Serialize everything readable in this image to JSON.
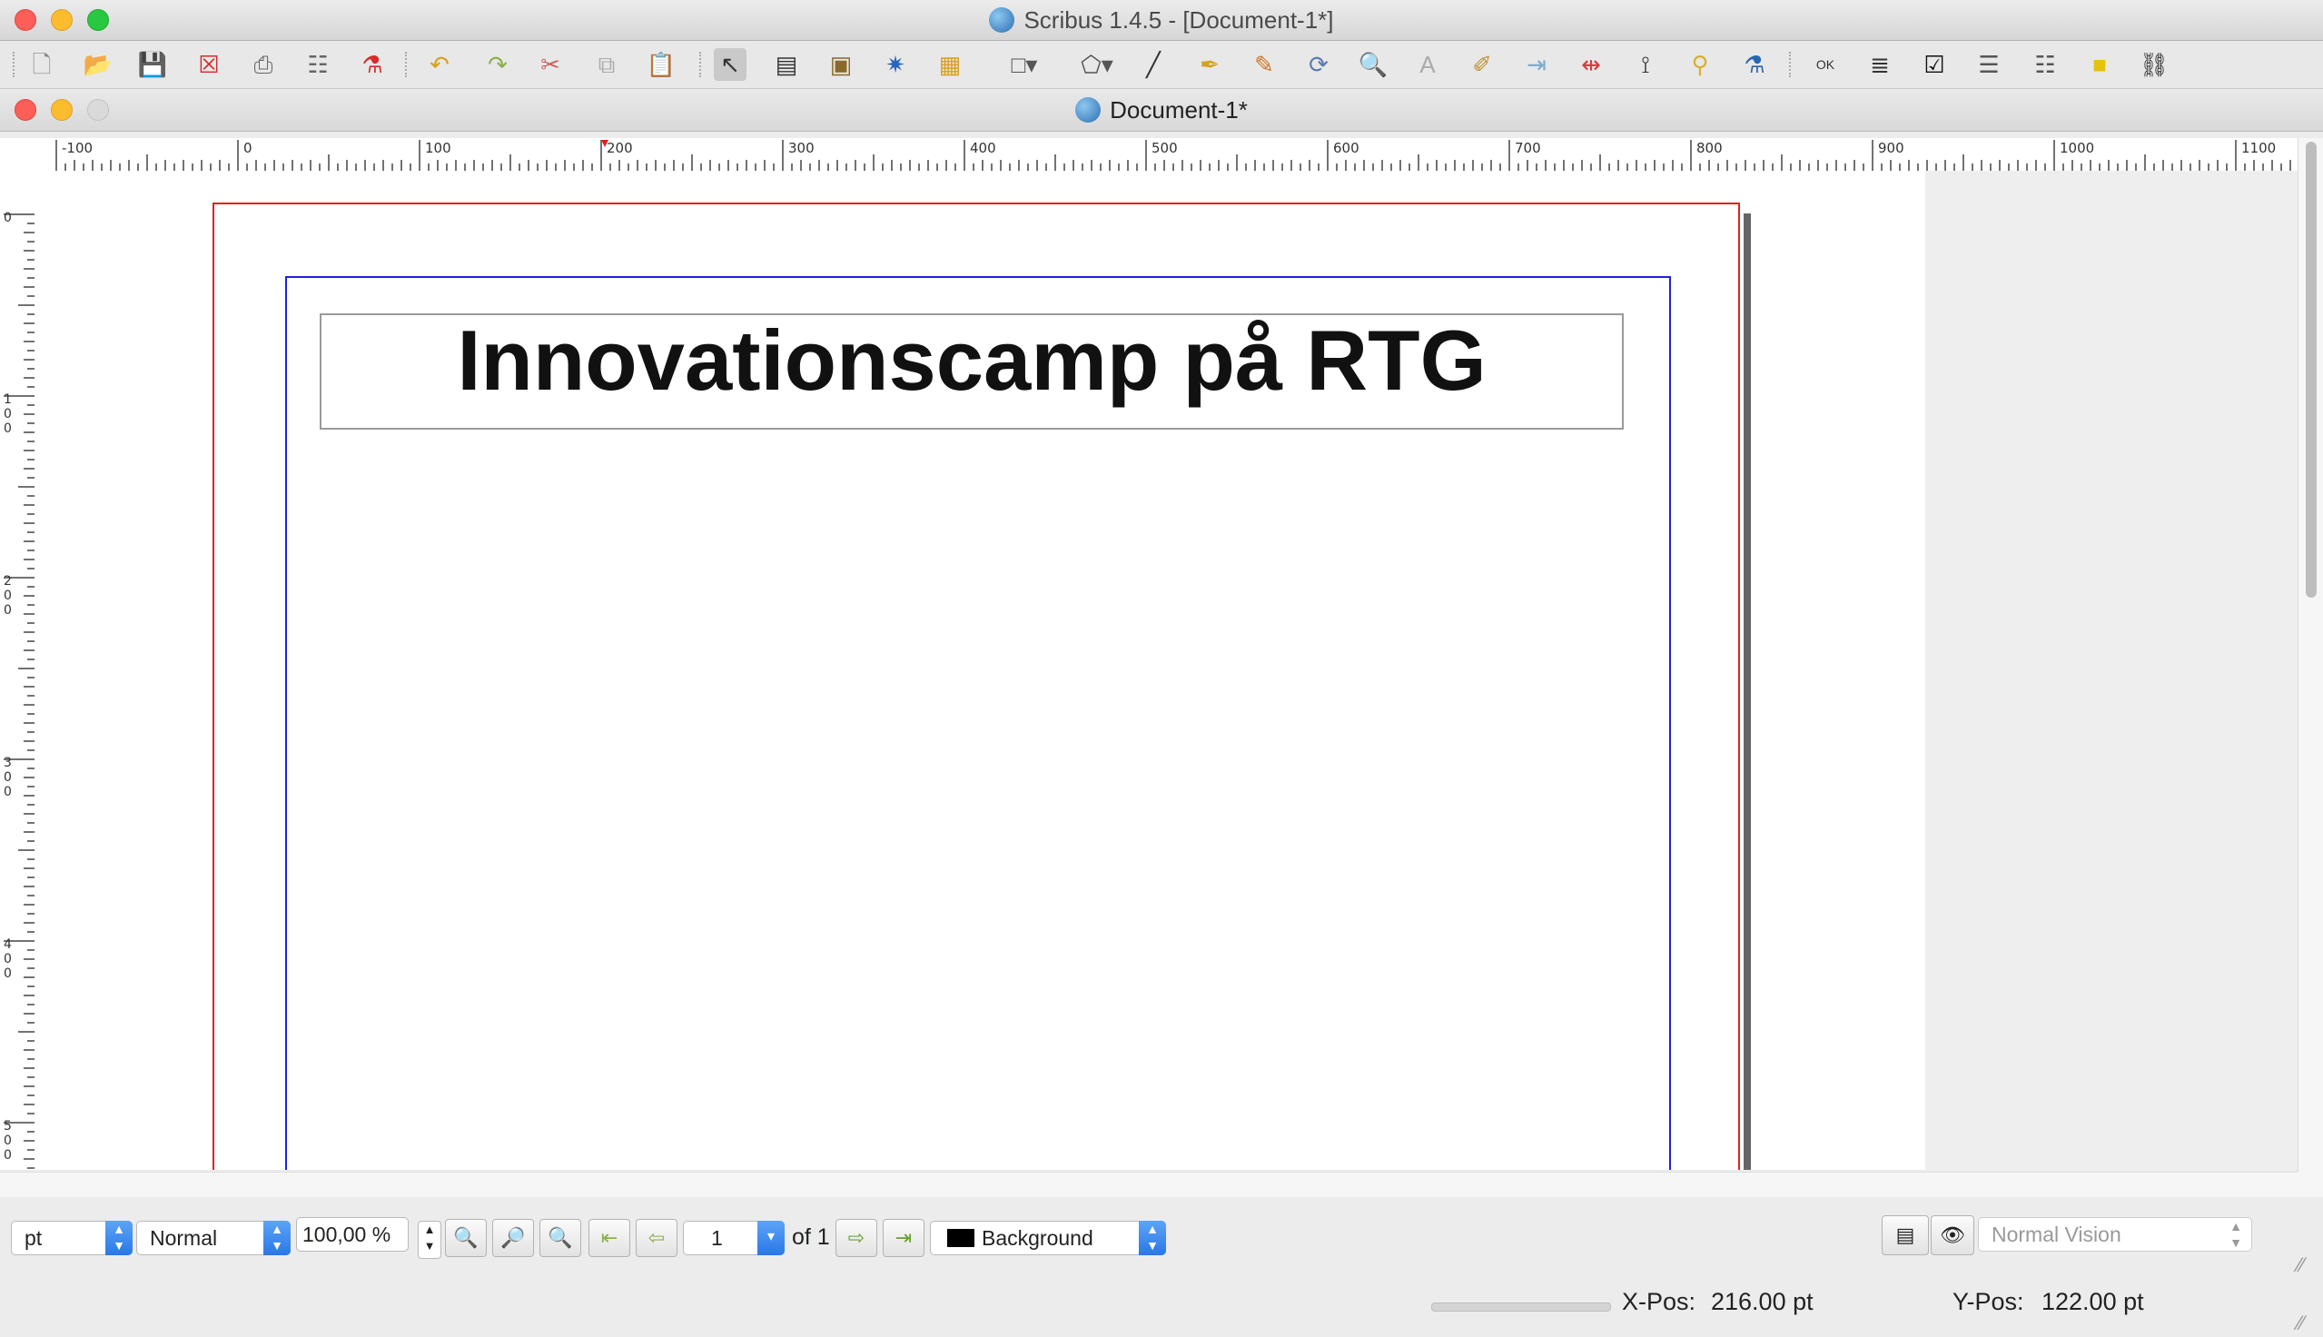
{
  "window": {
    "app_title": "Scribus 1.4.5 - [Document-1*]",
    "doc_title": "Document-1*"
  },
  "toolbar": {
    "icons": [
      "new-document-icon",
      "open-document-icon",
      "save-icon",
      "close-document-icon",
      "print-icon",
      "preflight-verifier-icon",
      "export-pdf-icon",
      "undo-icon",
      "redo-icon",
      "cut-icon",
      "copy-icon",
      "paste-icon",
      "select-item-icon",
      "text-frame-icon",
      "image-frame-icon",
      "render-frame-icon",
      "table-icon",
      "shape-icon",
      "polygon-icon",
      "line-icon",
      "bezier-curve-icon",
      "freehand-line-icon",
      "rotate-item-icon",
      "zoom-icon",
      "edit-contents-icon",
      "edit-text-story-editor-icon",
      "link-text-frames-icon",
      "unlink-text-frames-icon",
      "measurements-icon",
      "copy-item-properties-icon",
      "eyedropper-icon",
      "pdf-push-button-icon",
      "pdf-text-field-icon",
      "pdf-check-box-icon",
      "pdf-combo-box-icon",
      "pdf-list-box-icon",
      "text-annotation-icon",
      "link-annotation-icon"
    ]
  },
  "rulers": {
    "horizontal": [
      "-100",
      "0",
      "100",
      "200",
      "300",
      "400",
      "500",
      "600",
      "700",
      "800",
      "900",
      "1000",
      "1100"
    ],
    "vertical": [
      "0",
      "100",
      "200",
      "300",
      "400",
      "500"
    ]
  },
  "document": {
    "headline": "Innovationscamp på RTG"
  },
  "bottom": {
    "unit": "pt",
    "mode": "Normal",
    "zoom": "100,00 %",
    "page_current": "1",
    "page_total": "of 1",
    "layer": "Background",
    "vision": "Normal Vision",
    "x_label": "X-Pos:",
    "x_value": "216.00 pt",
    "y_label": "Y-Pos:",
    "y_value": "122.00 pt"
  },
  "colors": {
    "page_border": "#e02020",
    "margin_guide": "#2020e0",
    "layer_swatch": "#000000",
    "accent": "#2a77e8"
  }
}
